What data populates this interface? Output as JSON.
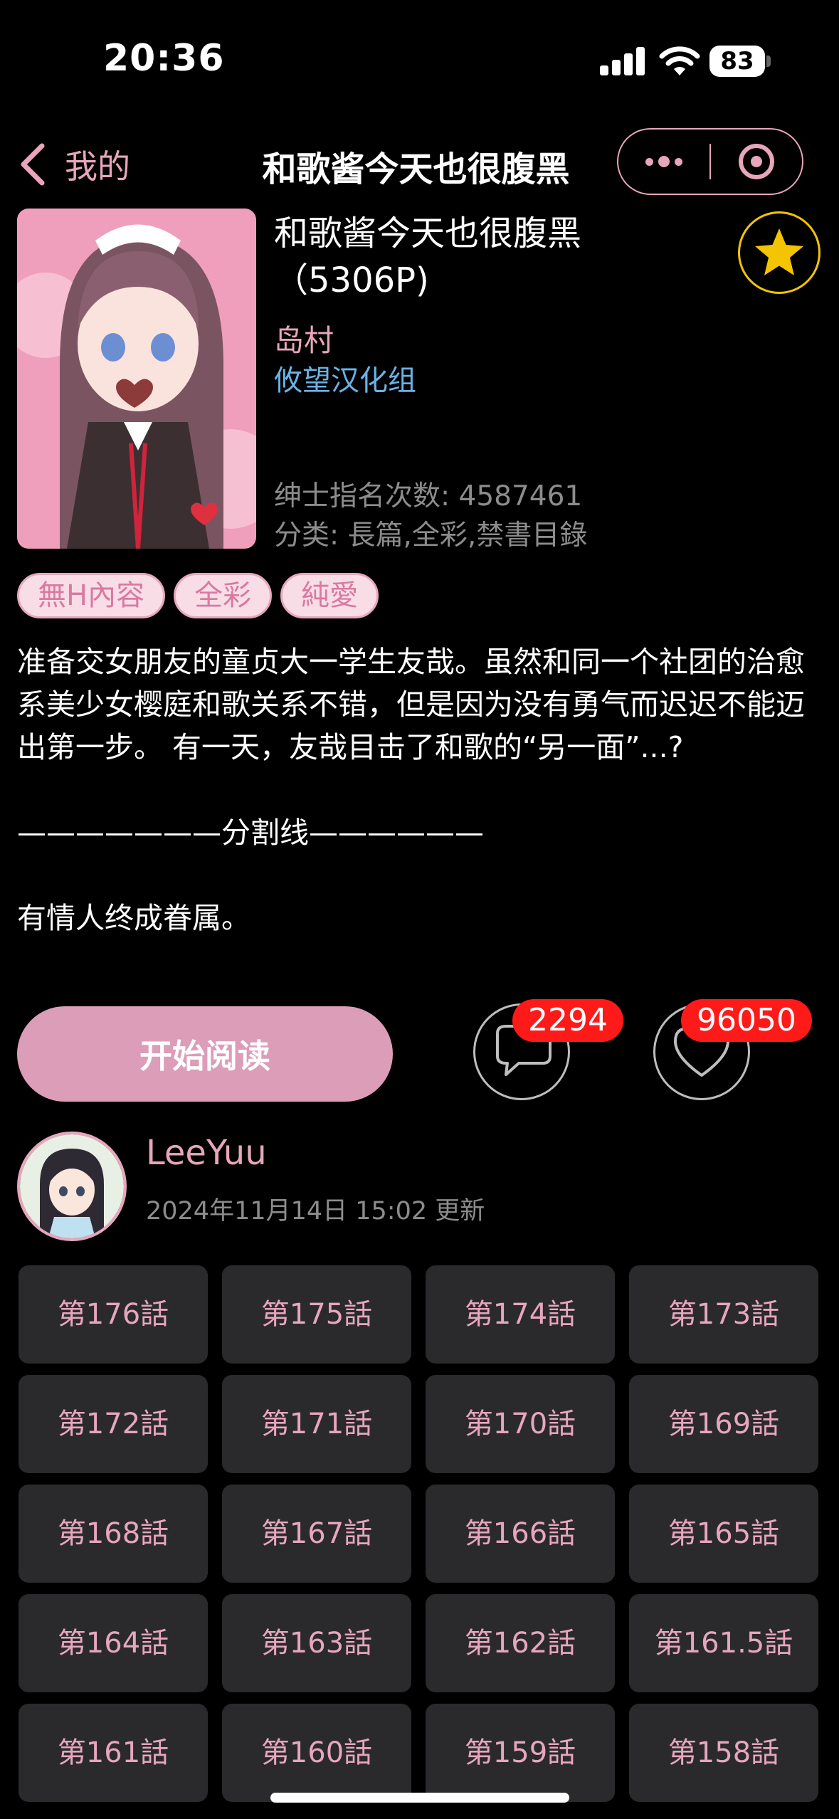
{
  "status_bar": {
    "time": "20:36",
    "battery": "83"
  },
  "nav": {
    "back_label": "我的",
    "title": "和歌酱今天也很腹黑"
  },
  "comic": {
    "title": "和歌酱今天也很腹黑（5306P)",
    "author": "岛村",
    "group": "攸望汉化组",
    "views": "绅士指名次数: 4587461",
    "category": "分类: 長篇,全彩,禁書目錄",
    "tags": [
      "無H內容",
      "全彩",
      "純愛"
    ],
    "description": "准备交女朋友的童贞大一学生友哉。虽然和同一个社团的治愈系美少女樱庭和歌关系不错，但是因为没有勇气而迟迟不能迈出第一步。 有一天，友哉目击了和歌的“另一面”...?\n\n———————分割线——————\n\n有情人终成眷属。"
  },
  "actions": {
    "read_label": "开始阅读",
    "comment_count": "2294",
    "like_count": "96050"
  },
  "uploader": {
    "name": "LeeYuu",
    "updated": "2024年11月14日 15:02 更新"
  },
  "chapters": [
    "第176話",
    "第175話",
    "第174話",
    "第173話",
    "第172話",
    "第171話",
    "第170話",
    "第169話",
    "第168話",
    "第167話",
    "第166話",
    "第165話",
    "第164話",
    "第163話",
    "第162話",
    "第161.5話",
    "第161話",
    "第160話",
    "第159話",
    "第158話"
  ],
  "colors": {
    "accent_pink": "#e7a6bd",
    "button_pink": "#dc9db8",
    "link_blue": "#6ab2e6",
    "badge_red": "#ff1a1a",
    "star_yellow": "#f5c400"
  }
}
